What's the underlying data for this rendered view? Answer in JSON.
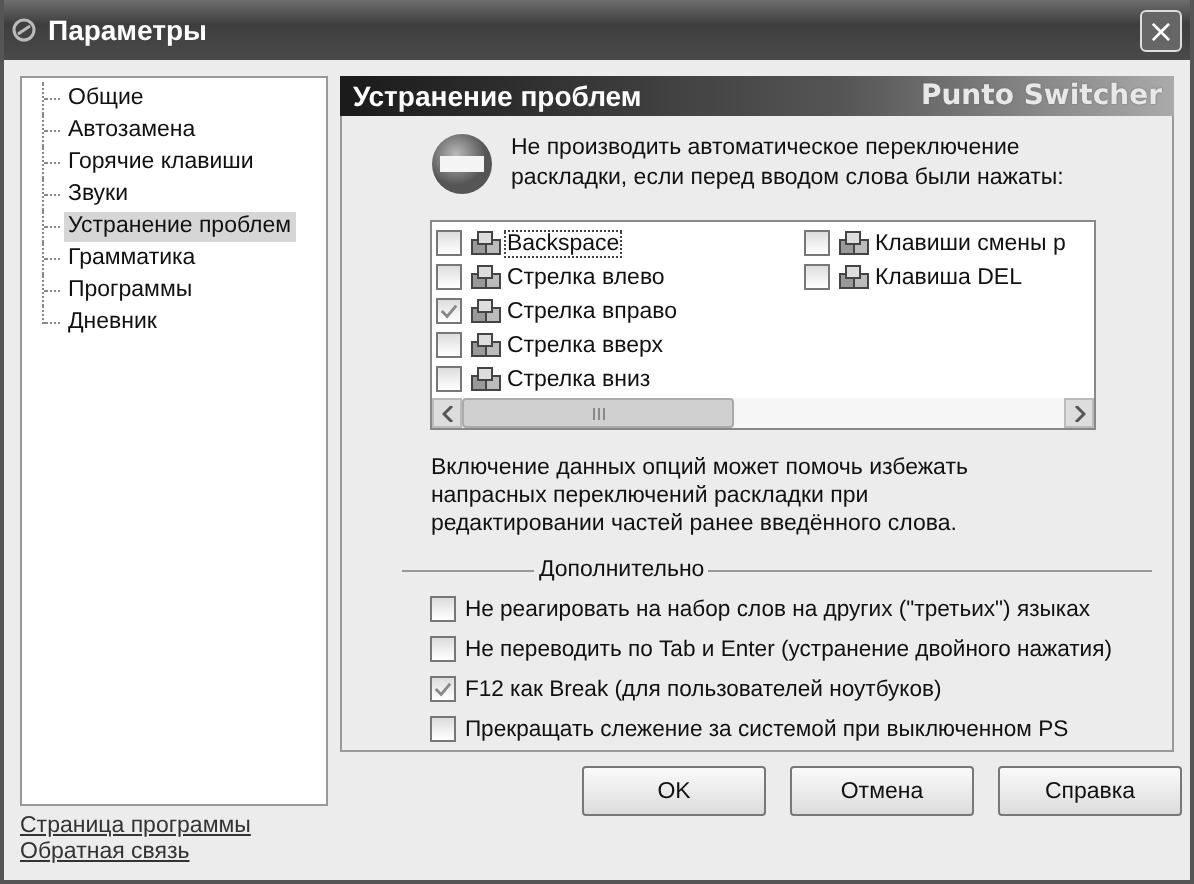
{
  "window": {
    "title": "Параметры",
    "close": "×"
  },
  "sidebar": {
    "items": [
      {
        "label": "Общие",
        "selected": false
      },
      {
        "label": "Автозамена",
        "selected": false
      },
      {
        "label": "Горячие клавиши",
        "selected": false
      },
      {
        "label": "Звуки",
        "selected": false
      },
      {
        "label": "Устранение проблем",
        "selected": true
      },
      {
        "label": "Грамматика",
        "selected": false
      },
      {
        "label": "Программы",
        "selected": false
      },
      {
        "label": "Дневник",
        "selected": false
      }
    ],
    "links": [
      "Страница программы",
      "Обратная связь"
    ]
  },
  "panel": {
    "title": "Устранение проблем",
    "brand": "Punto Switcher",
    "intro": "Не производить автоматическое переключение раскладки, если перед вводом слова были нажаты:",
    "key_columns": [
      {
        "keys": [
          {
            "label": "Backspace",
            "checked": false
          },
          {
            "label": "Стрелка влево",
            "checked": false
          },
          {
            "label": "Стрелка вправо",
            "checked": true
          },
          {
            "label": "Стрелка вверх",
            "checked": false
          },
          {
            "label": "Стрелка вниз",
            "checked": false
          }
        ]
      },
      {
        "keys": [
          {
            "label": "Клавиши смены р",
            "checked": false
          },
          {
            "label": "Клавиша DEL",
            "checked": false
          }
        ]
      }
    ],
    "note": "Включение данных опций может помочь избежать напрасных переключений раскладки при редактировании частей ранее введённого слова.",
    "group_title": "Дополнительно",
    "options": [
      {
        "label": "Не реагировать на набор слов на других (\"третьих\") языках",
        "checked": false
      },
      {
        "label": "Не переводить по Tab и Enter (устранение двойного нажатия)",
        "checked": false
      },
      {
        "label": "F12 как Break (для пользователей ноутбуков)",
        "checked": true
      },
      {
        "label": "Прекращать слежение за системой при выключенном PS",
        "checked": false
      }
    ]
  },
  "buttons": [
    "OK",
    "Отмена",
    "Справка"
  ]
}
